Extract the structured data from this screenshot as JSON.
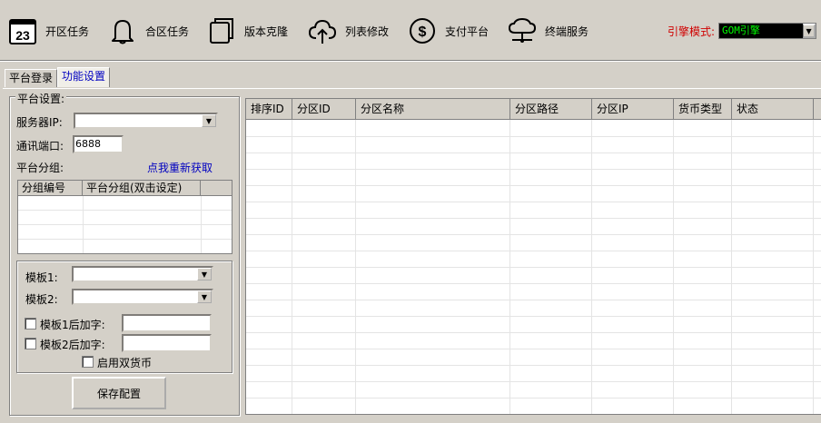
{
  "toolbar": {
    "items": [
      {
        "icon": "calendar-icon",
        "icon_text": "23",
        "label": "开区任务"
      },
      {
        "icon": "bell-icon",
        "label": "合区任务"
      },
      {
        "icon": "copy-icon",
        "label": "版本克隆"
      },
      {
        "icon": "cloud-upload-icon",
        "label": "列表修改"
      },
      {
        "icon": "dollar-icon",
        "icon_text": "$",
        "label": "支付平台"
      },
      {
        "icon": "network-icon",
        "label": "终端服务"
      }
    ],
    "engine_label": "引擎模式:",
    "engine_value": "GOM引擎"
  },
  "tabs": [
    "平台登录",
    "功能设置"
  ],
  "platform": {
    "legend": "平台设置:",
    "server_ip_label": "服务器IP:",
    "server_ip_value": "",
    "port_label": "通讯端口:",
    "port_value": "6888",
    "group_label": "平台分组:",
    "refresh_link": "点我重新获取",
    "group_columns": [
      "分组编号",
      "平台分组(双击设定)"
    ]
  },
  "templates": {
    "template1_label": "模板1:",
    "template2_label": "模板2:",
    "suffix1_label": "模板1后加字:",
    "suffix2_label": "模板2后加字:",
    "dual_currency_label": "启用双货币",
    "save_label": "保存配置"
  },
  "grid": {
    "columns": [
      "排序ID",
      "分区ID",
      "分区名称",
      "分区路径",
      "分区IP",
      "货币类型",
      "状态"
    ]
  },
  "colors": {
    "engine_label": "#d00000",
    "engine_value": "#00ff00",
    "link": "#0000c0"
  }
}
